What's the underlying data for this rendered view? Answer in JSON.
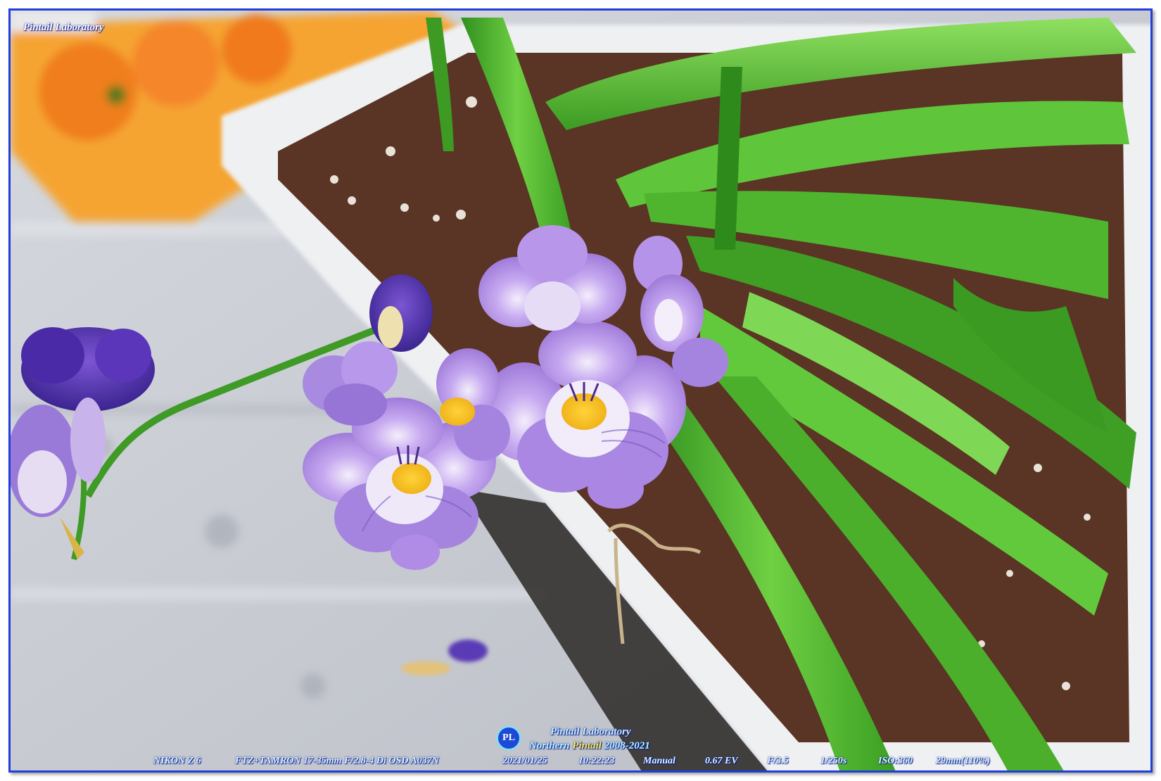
{
  "watermark": {
    "top_left": "Pintail Laboratory",
    "logo_glyph": "PL",
    "center_line1": "Pintail Laboratory",
    "center_line2_prefix": "Northern ",
    "center_line2_highlight": "Pintail",
    "center_line2_years": " 2008-2021"
  },
  "exif": {
    "camera": "NIKON Z 6",
    "lens": "FTZ+TAMRON 17-35mm F/2.8-4 Di OSD A037N",
    "date": "2021/01/25",
    "time": "10:22:23",
    "mode": "Manual",
    "ev": "0.67 EV",
    "aperture": "F/3.5",
    "shutter": "1/250s",
    "iso": "ISO:360",
    "focal": "29mm(110%)"
  },
  "colors": {
    "frame_border": "#1f3fd8",
    "petal_lavender": "#b493e8",
    "petal_violet": "#6a3fc0",
    "leaf_green": "#4fb52e",
    "soil_brown": "#5a3424",
    "planter_white": "#eef0f2",
    "orange_box": "#f39a2a"
  }
}
